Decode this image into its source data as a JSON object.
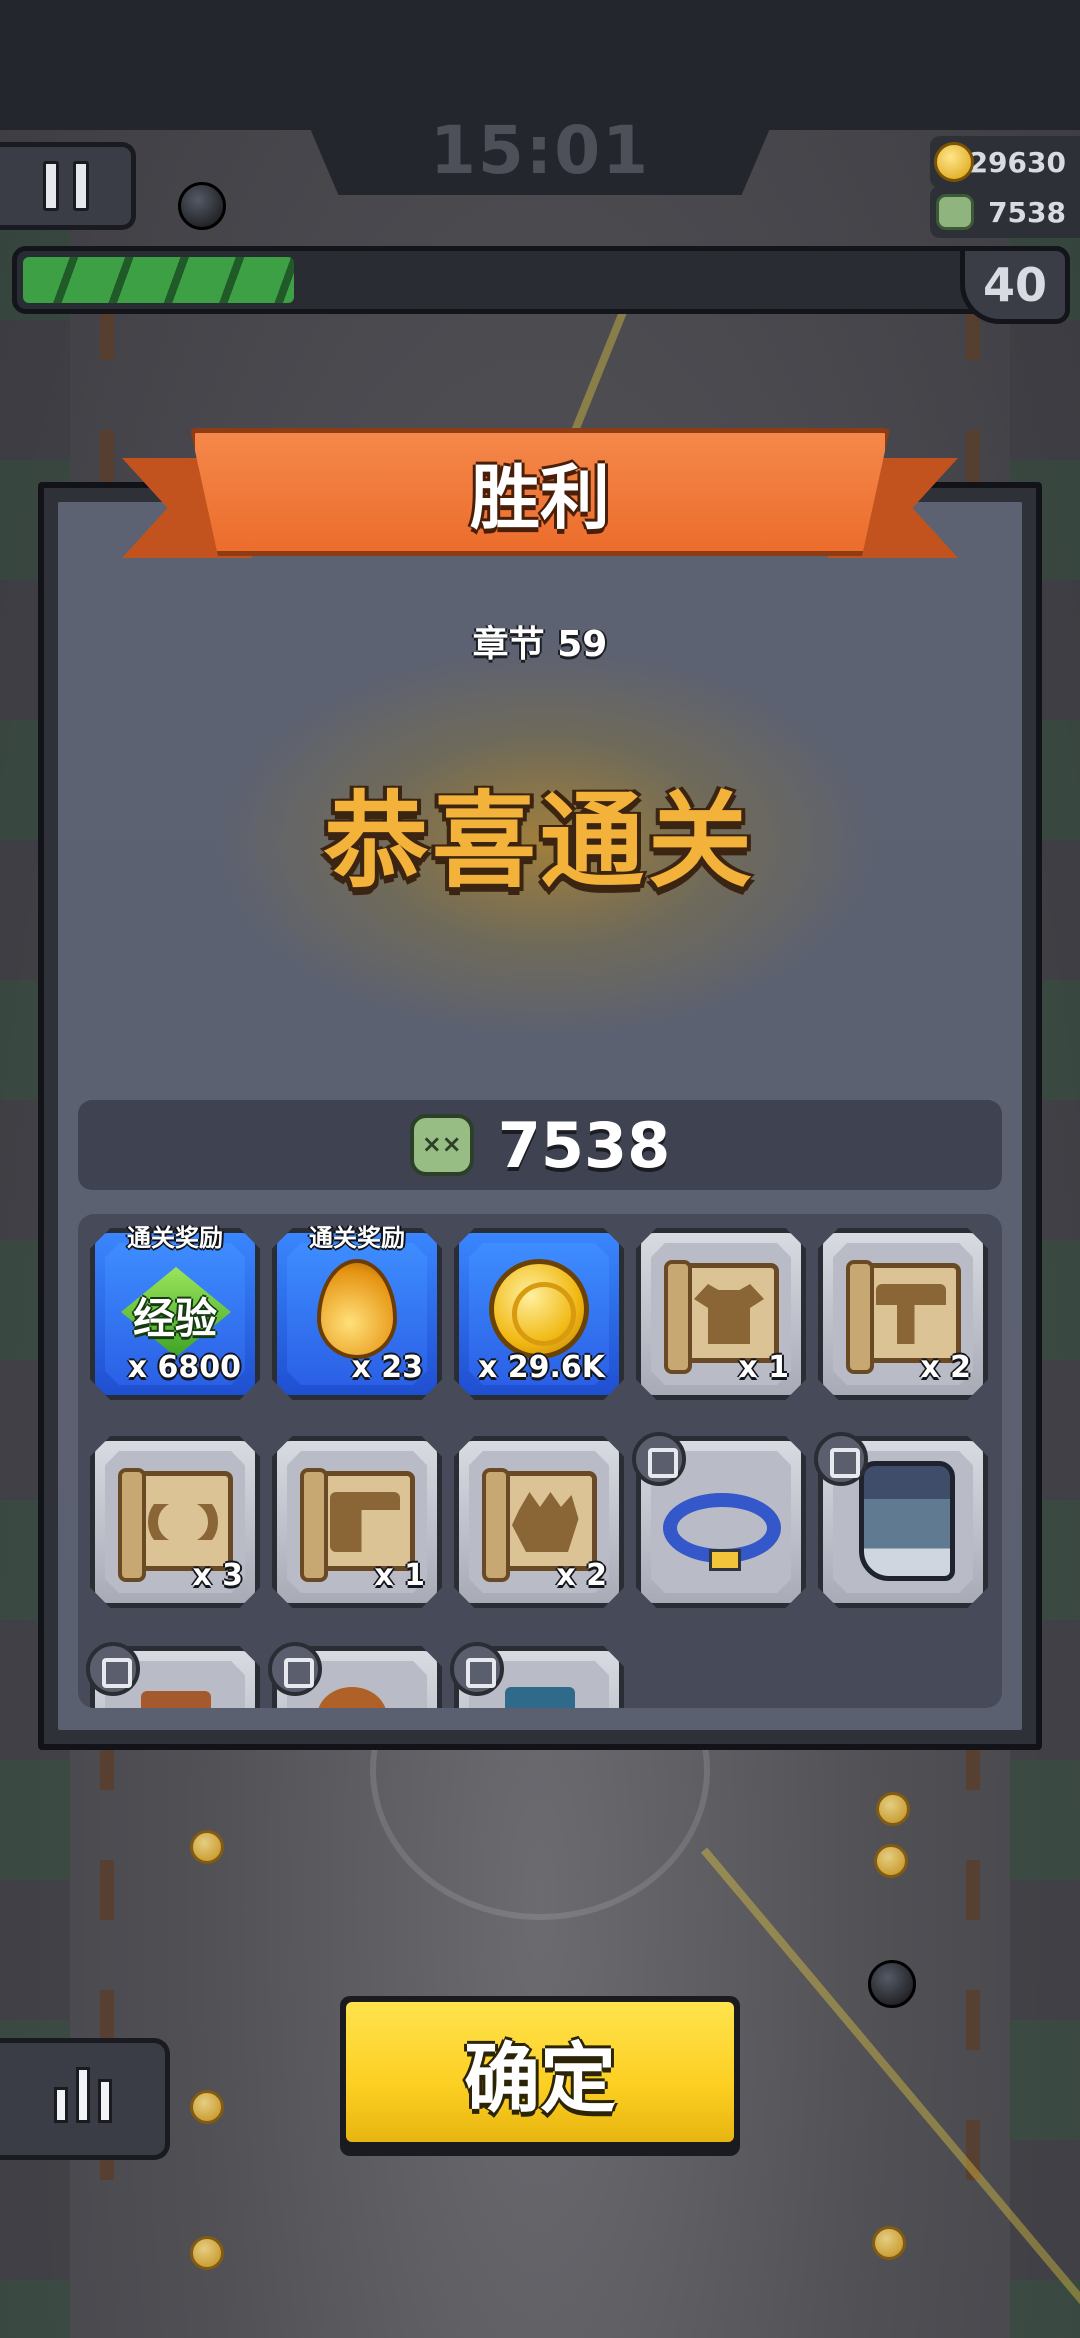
{
  "hud": {
    "timer": "15:01",
    "gold": "29630",
    "kills": "7538",
    "level": "40",
    "progress_fraction": 0.29
  },
  "result": {
    "title": "胜利",
    "chapter": "章节 59",
    "headline": "恭喜通关",
    "kill_count": "7538"
  },
  "rewards": [
    {
      "tag": "通关奖励",
      "icon": "exp-gem-icon",
      "label": "经验",
      "count": "x 6800",
      "style": "blue"
    },
    {
      "tag": "通关奖励",
      "icon": "energy-drop-icon",
      "count": "x 23",
      "style": "blue"
    },
    {
      "icon": "gold-coin-icon",
      "count": "x 29.6K",
      "style": "blue"
    },
    {
      "icon": "armor-blueprint-icon",
      "count": "x 1",
      "style": "gray"
    },
    {
      "icon": "weapon-blueprint-icon",
      "count": "x 2",
      "style": "gray"
    },
    {
      "icon": "belt-blueprint-icon",
      "count": "x 3",
      "style": "gray"
    },
    {
      "icon": "pants-blueprint-icon",
      "count": "x 1",
      "style": "gray"
    },
    {
      "icon": "glove-blueprint-icon",
      "count": "x 2",
      "style": "gray"
    },
    {
      "icon": "blue-belt-icon",
      "style": "gray"
    },
    {
      "icon": "boots-icon",
      "style": "gray"
    },
    {
      "icon": "armor-icon",
      "style": "gray"
    },
    {
      "icon": "necklace-icon",
      "style": "gray"
    },
    {
      "icon": "pants-icon",
      "style": "gray"
    }
  ],
  "buttons": {
    "confirm": "确定"
  },
  "colors": {
    "ribbon": "#ec6d2c",
    "headline": "#f3b23a",
    "confirm": "#fccf22",
    "progress": "#3ea045",
    "reward_blue": "#2b60e6"
  }
}
